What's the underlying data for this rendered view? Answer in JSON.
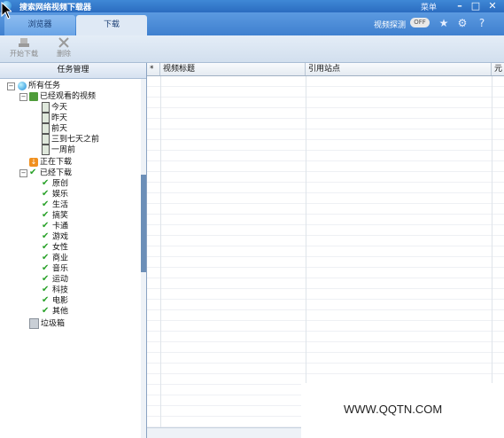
{
  "titlebar": {
    "title": "搜索网络视频下载器",
    "menu_label": "菜单",
    "minimize": "–",
    "maximize": "□",
    "close": "✕"
  },
  "tabs": [
    {
      "label": "浏览器",
      "active": false
    },
    {
      "label": "下载",
      "active": true
    }
  ],
  "header_controls": {
    "detect_label": "视频探测",
    "detect_toggle": "OFF",
    "icons": [
      "star-icon",
      "gear-icon",
      "help-icon"
    ]
  },
  "toolbar": {
    "start_label": "开始下载",
    "delete_label": "删除"
  },
  "left_panel": {
    "heading": "任务管理",
    "root": "所有任务",
    "watched": "已经观看的视频",
    "watched_children": [
      "今天",
      "昨天",
      "前天",
      "三到七天之前",
      "一周前"
    ],
    "downloading": "正在下载",
    "downloaded": "已经下载",
    "downloaded_children": [
      "原创",
      "娱乐",
      "生活",
      "搞笑",
      "卡通",
      "游戏",
      "女性",
      "商业",
      "音乐",
      "运动",
      "科技",
      "电影",
      "其他"
    ],
    "trash": "垃圾箱"
  },
  "grid": {
    "columns": [
      "*",
      "视频标题",
      "引用站点",
      "元"
    ]
  },
  "watermark": "WWW.QQTN.COM",
  "colors": {
    "titlebar": "#2b6cc0",
    "tabbar": "#4a8bd8",
    "panel_border": "#8aa3c2"
  }
}
